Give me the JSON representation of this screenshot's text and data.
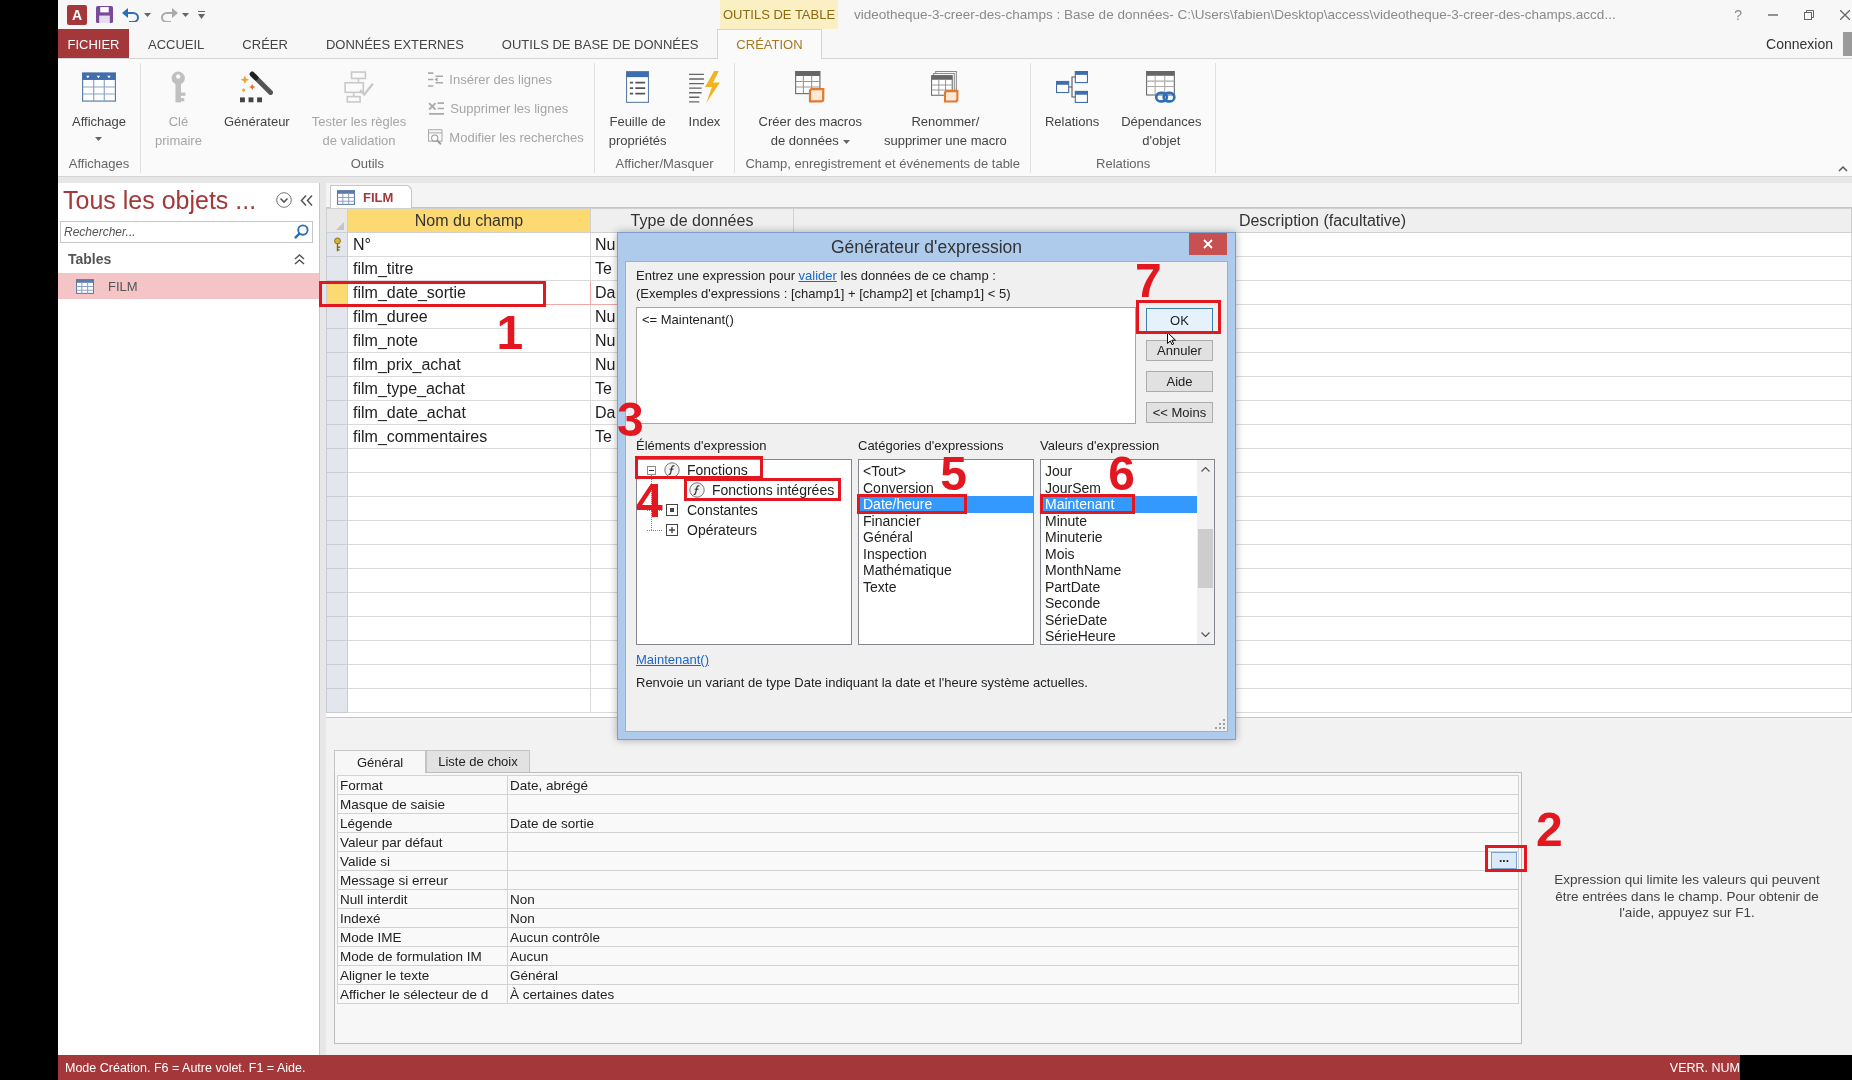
{
  "window": {
    "logo": "A",
    "context_group": "OUTILS DE TABLE",
    "title": "videotheque-3-creer-des-champs : Base de données- C:\\Users\\fabien\\Desktop\\access\\videotheque-3-creer-des-champs.accd...",
    "help": "?"
  },
  "ribbon_tabs": [
    {
      "label": "FICHIER",
      "kind": "file",
      "selected": false
    },
    {
      "label": "ACCUEIL",
      "kind": "tab",
      "selected": false
    },
    {
      "label": "CRÉER",
      "kind": "tab",
      "selected": false
    },
    {
      "label": "DONNÉES EXTERNES",
      "kind": "tab",
      "selected": false
    },
    {
      "label": "OUTILS DE BASE DE DONNÉES",
      "kind": "tab",
      "selected": false
    },
    {
      "label": "CRÉATION",
      "kind": "contextual",
      "selected": true
    }
  ],
  "account": {
    "label": "Connexion"
  },
  "ribbon_groups": [
    {
      "label": "Affichages",
      "buttons": [
        {
          "kind": "view",
          "label": "Affichage",
          "dropdown": true,
          "disabled": false
        }
      ]
    },
    {
      "label": "Outils",
      "buttons": [
        {
          "kind": "key",
          "label": "Clé\nprimaire",
          "dropdown": false,
          "disabled": true
        },
        {
          "kind": "builder",
          "label": "Générateur",
          "dropdown": false,
          "disabled": false
        },
        {
          "kind": "validate",
          "label": "Tester les règles\nde validation",
          "dropdown": false,
          "disabled": true
        }
      ],
      "small_buttons": [
        {
          "kind": "insert-rows",
          "label": "Insérer des lignes",
          "disabled": true
        },
        {
          "kind": "delete-rows",
          "label": "Supprimer les lignes",
          "disabled": true
        },
        {
          "kind": "lookup",
          "label": "Modifier les recherches",
          "disabled": true
        }
      ]
    },
    {
      "label": "Afficher/Masquer",
      "buttons": [
        {
          "kind": "sheet",
          "label": "Feuille de\npropriétés",
          "dropdown": false,
          "disabled": false
        },
        {
          "kind": "index",
          "label": "Index",
          "dropdown": false,
          "disabled": false
        }
      ]
    },
    {
      "label": "Champ, enregistrement et événements de table",
      "buttons": [
        {
          "kind": "macro",
          "label": "Créer des macros\nde données",
          "dropdown": true,
          "disabled": false
        },
        {
          "kind": "rename-macro",
          "label": "Renommer/\nsupprimer une macro",
          "dropdown": false,
          "disabled": false
        }
      ]
    },
    {
      "label": "Relations",
      "buttons": [
        {
          "kind": "relations",
          "label": "Relations",
          "dropdown": false,
          "disabled": false
        },
        {
          "kind": "dependencies",
          "label": "Dépendances\nd'objet",
          "dropdown": false,
          "disabled": false
        }
      ]
    }
  ],
  "navigation": {
    "title": "Tous les objets ...",
    "search_placeholder": "Rechercher...",
    "groups": [
      {
        "label": "Tables",
        "expanded": true,
        "items": [
          {
            "label": "FILM",
            "selected": true
          }
        ]
      }
    ]
  },
  "document": {
    "tabs": [
      {
        "label": "FILM",
        "selected": true
      }
    ],
    "columns": [
      {
        "label": "Nom du champ",
        "selected": true
      },
      {
        "label": "Type de données",
        "selected": false
      },
      {
        "label": "Description (facultative)",
        "selected": false
      }
    ],
    "fields": [
      {
        "name": "N°",
        "type": "Nu",
        "primary_key": true,
        "selected": false
      },
      {
        "name": "film_titre",
        "type": "Te",
        "primary_key": false,
        "selected": false
      },
      {
        "name": "film_date_sortie",
        "type": "Da",
        "primary_key": false,
        "selected": true,
        "annotation": "1"
      },
      {
        "name": "film_duree",
        "type": "Nu",
        "primary_key": false,
        "selected": false
      },
      {
        "name": "film_note",
        "type": "Nu",
        "primary_key": false,
        "selected": false
      },
      {
        "name": "film_prix_achat",
        "type": "Nu",
        "primary_key": false,
        "selected": false
      },
      {
        "name": "film_type_achat",
        "type": "Te",
        "primary_key": false,
        "selected": false
      },
      {
        "name": "film_date_achat",
        "type": "Da",
        "primary_key": false,
        "selected": false
      },
      {
        "name": "film_commentaires",
        "type": "Te",
        "primary_key": false,
        "selected": false
      }
    ]
  },
  "properties": {
    "tabs": [
      {
        "label": "Général",
        "selected": true
      },
      {
        "label": "Liste de choix",
        "selected": false
      }
    ],
    "rows": [
      {
        "label": "Format",
        "value": "Date, abrégé"
      },
      {
        "label": "Masque de saisie"
      },
      {
        "label": "Légende",
        "value": "Date de sortie"
      },
      {
        "label": "Valeur par défaut"
      },
      {
        "label": "Valide si",
        "builder": "...",
        "annotation": "2"
      },
      {
        "label": "Message si erreur"
      },
      {
        "label": "Null interdit",
        "value": "Non"
      },
      {
        "label": "Indexé",
        "value": "Non"
      },
      {
        "label": "Mode IME",
        "value": "Aucun contrôle"
      },
      {
        "label": "Mode de formulation IM",
        "value": "Aucun"
      },
      {
        "label": "Aligner le texte",
        "value": "Général"
      },
      {
        "label": "Afficher le sélecteur de d",
        "value": "À certaines dates"
      }
    ],
    "help": "Expression qui limite les valeurs qui peuvent être entrées dans le champ. Pour obtenir de l'aide, appuyez sur F1."
  },
  "dialog": {
    "title": "Générateur d'expression",
    "instruction": {
      "before": "Entrez une expression pour",
      "link": "valider",
      "after": "les données de ce champ :"
    },
    "example": "(Exemples d'expressions : [champ1] + [champ2] et [champ1] < 5)",
    "expression": "<= Maintenant()",
    "buttons": [
      {
        "label": "OK",
        "default": true,
        "annotation": "7"
      },
      {
        "label": "Annuler",
        "default": false
      },
      {
        "label": "Aide",
        "default": false
      },
      {
        "label": "<< Moins",
        "default": false
      }
    ],
    "elements_label": "Éléments d'expression",
    "elements": [
      {
        "label": "Fonctions",
        "kind": "function",
        "expanded": true,
        "selected": false,
        "annotation": "3",
        "children": [
          {
            "label": "Fonctions intégrées",
            "kind": "function",
            "selected": false,
            "annotation": "4"
          }
        ]
      },
      {
        "label": "Constantes",
        "kind": "constant",
        "selected": false
      },
      {
        "label": "Opérateurs",
        "kind": "operator",
        "selected": false
      }
    ],
    "categories_label": "Catégories d'expressions",
    "categories": [
      {
        "label": "<Tout>",
        "selected": false
      },
      {
        "label": "Conversion",
        "selected": false
      },
      {
        "label": "Date/heure",
        "selected": true,
        "annotation": "5"
      },
      {
        "label": "Financier",
        "selected": false
      },
      {
        "label": "Général",
        "selected": false
      },
      {
        "label": "Inspection",
        "selected": false
      },
      {
        "label": "Mathématique",
        "selected": false
      },
      {
        "label": "Texte",
        "selected": false
      }
    ],
    "values_label": "Valeurs d'expression",
    "values": [
      {
        "label": "Jour",
        "selected": false
      },
      {
        "label": "JourSem",
        "selected": false
      },
      {
        "label": "Maintenant",
        "selected": true,
        "annotation": "6"
      },
      {
        "label": "Minute",
        "selected": false
      },
      {
        "label": "Minuterie",
        "selected": false
      },
      {
        "label": "Mois",
        "selected": false
      },
      {
        "label": "MonthName",
        "selected": false
      },
      {
        "label": "PartDate",
        "selected": false
      },
      {
        "label": "Seconde",
        "selected": false
      },
      {
        "label": "SérieDate",
        "selected": false
      },
      {
        "label": "SérieHeure",
        "selected": false
      }
    ],
    "function_link": "Maintenant()",
    "function_description": "Renvoie un variant de type Date indiquant la date et l'heure système actuelles."
  },
  "status_bar": {
    "text": "Mode Création. F6 = Autre volet. F1 = Aide.",
    "indicator": "VERR. NUM"
  }
}
